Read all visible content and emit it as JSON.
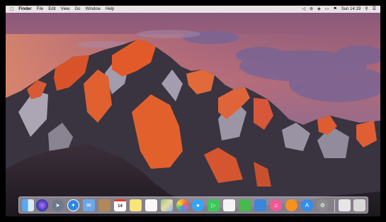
{
  "menubar": {
    "apple_icon": "apple-logo-icon",
    "app_name": "Finder",
    "items": [
      "File",
      "Edit",
      "View",
      "Go",
      "Window",
      "Help"
    ],
    "status_icons": [
      "volume-icon",
      "bluetooth-icon",
      "wifi-icon",
      "battery-icon",
      "flag-icon"
    ],
    "clock": "Sun 14:19",
    "right_icons": [
      "search-icon",
      "list-icon"
    ]
  },
  "dock": {
    "calendar_day": "14",
    "icons": [
      "finder-icon",
      "siri-icon",
      "launchpad-icon",
      "safari-icon",
      "mail-icon",
      "contacts-icon",
      "calendar-icon",
      "notes-icon",
      "reminders-icon",
      "maps-icon",
      "photos-icon",
      "messages-icon",
      "facetime-icon",
      "pages-icon",
      "numbers-icon",
      "keynote-icon",
      "itunes-icon",
      "ibooks-icon",
      "app-store-icon",
      "system-preferences-icon",
      "downloads-icon",
      "trash-icon"
    ]
  },
  "colors": {
    "menubar": "#f0eef0",
    "sky_top": "#8e5c7e",
    "sky_horizon": "#e0816a",
    "mountain_lit": "#e0582a",
    "mountain_shadow": "#2c2431"
  }
}
